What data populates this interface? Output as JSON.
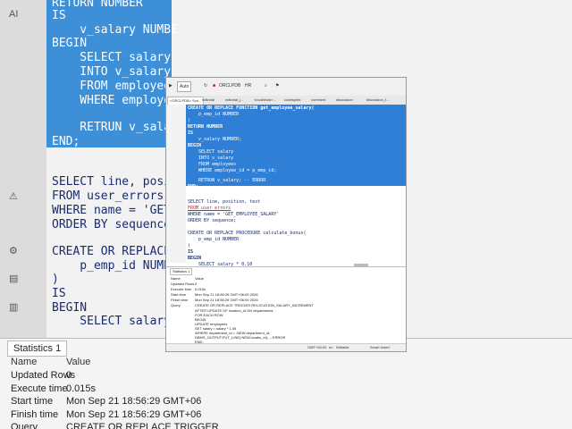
{
  "background": {
    "code_lines": [
      "RETURN NUMBER",
      "IS",
      "    v_salary NUMBE",
      "BEGIN",
      "    SELECT salary",
      "    INTO v_salary",
      "    FROM employees",
      "    WHERE employee",
      "",
      "    RETRUN v_salar",
      "END;",
      "",
      "",
      "SELECT line, positio",
      "FROM user_errors",
      "WHERE name = 'GET_",
      "ORDER BY sequence;",
      "",
      "CREATE OR REPLACE",
      "    p_emp_id NUMBE",
      ")",
      "IS",
      "BEGIN",
      "    SELECT salary"
    ],
    "stats_tab": "Statistics 1",
    "rows": [
      {
        "name": "Name",
        "value": "Value"
      },
      {
        "name": "Updated Rows",
        "value": "0"
      },
      {
        "name": "Execute time",
        "value": "0.015s"
      },
      {
        "name": "Start time",
        "value": "Mon Sep 21 18:56:29 GMT+06"
      },
      {
        "name": "Finish time",
        "value": "Mon Sep 21 18:56:29 GMT+06"
      },
      {
        "name": "Query",
        "value": "CREATE OR REPLACE TRIGGER"
      }
    ]
  },
  "window": {
    "toolbar": {
      "mode": "Auto",
      "connection": "ORCLPDB",
      "schema": "HR"
    },
    "tabs": [
      "<ORCLPDB> Scri...",
      "editorial",
      "editorial_j...",
      "<local\\host>...",
      "codesprint",
      "comment",
      "discussion",
      "discussion_t..."
    ],
    "code": [
      "CREATE OR REPLACE FUNCTION get_employee_salary(",
      "    p_emp_id NUMBER",
      ")",
      "RETURN NUMBER",
      "IS",
      "    v_salary NUMBER;",
      "BEGIN",
      "    SELECT salary",
      "    INTO v_salary",
      "    FROM employees",
      "    WHERE employee_id = p_emp_id;",
      "",
      "    RETRUN v_salary; -- ERROR",
      "END;",
      "",
      "",
      "SELECT line, position, text",
      "FROM user_errors",
      "WHERE name = 'GET_EMPLOYEE_SALARY'",
      "ORDER BY sequence;",
      "",
      "CREATE OR REPLACE PROCEDURE calculate_bonus(",
      "    p_emp_id NUMBER",
      ")",
      "IS",
      "BEGIN",
      "    SELECT salary * 0.10"
    ],
    "stats_tab": "Statistics 1",
    "stats": [
      {
        "name": "Name",
        "value": "Value"
      },
      {
        "name": "Updated Rows",
        "value": "0"
      },
      {
        "name": "Execute time",
        "value": "0.015s"
      },
      {
        "name": "Start time",
        "value": "Mon Sep 21 18:56:29 GMT+06:00 2026"
      },
      {
        "name": "Finish time",
        "value": "Mon Sep 21 18:56:29 GMT+06:00 2026"
      },
      {
        "name": "Query",
        "value": "CREATE OR REPLACE TRIGGER RELOCATION_SALARY_INCREMENT"
      }
    ],
    "query_lines": [
      "AFTER UPDATE OF location_id ON departments",
      "FOR EACH ROW",
      "BEGIN",
      "    UPDATE employees",
      "    SET salary = salary * 1.05",
      "    WHERE department_id = :NEW.department_id;",
      "    DBMS_OUTPUT.PUT_LINE(:NEW.locatio_id); -- ERROR",
      "END;"
    ],
    "status": {
      "tz": "GMT+06:00",
      "lang": "en",
      "mode": "Writable",
      "insert": "Smart Insert"
    }
  }
}
